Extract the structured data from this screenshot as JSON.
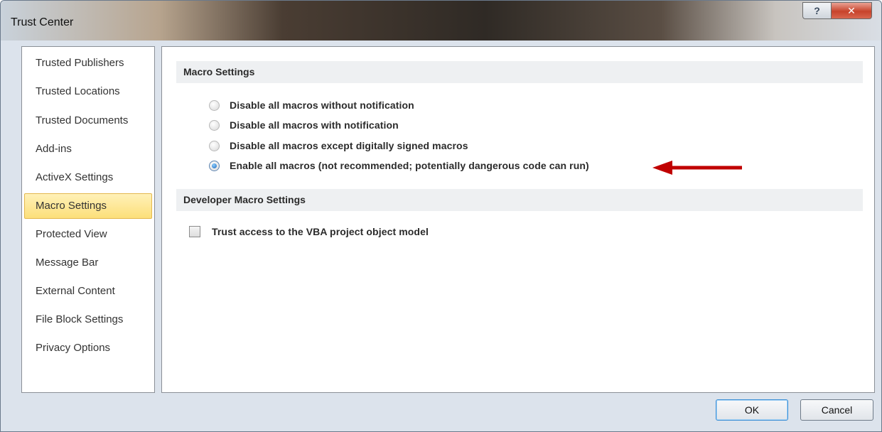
{
  "window": {
    "title": "Trust Center",
    "help_glyph": "?",
    "close_glyph": "✕"
  },
  "nav": {
    "items": [
      {
        "label": "Trusted Publishers"
      },
      {
        "label": "Trusted Locations"
      },
      {
        "label": "Trusted Documents"
      },
      {
        "label": "Add-ins"
      },
      {
        "label": "ActiveX Settings"
      },
      {
        "label": "Macro Settings",
        "selected": true
      },
      {
        "label": "Protected View"
      },
      {
        "label": "Message Bar"
      },
      {
        "label": "External Content"
      },
      {
        "label": "File Block Settings"
      },
      {
        "label": "Privacy Options"
      }
    ]
  },
  "macro_settings": {
    "header": "Macro Settings",
    "options": [
      {
        "label": "Disable all macros without notification",
        "checked": false
      },
      {
        "label": "Disable all macros with notification",
        "checked": false
      },
      {
        "label": "Disable all macros except digitally signed macros",
        "checked": false
      },
      {
        "label": "Enable all macros (not recommended; potentially dangerous code can run)",
        "checked": true
      }
    ]
  },
  "developer_settings": {
    "header": "Developer Macro Settings",
    "checkbox_label": "Trust access to the VBA project object model",
    "checked": false
  },
  "buttons": {
    "ok": "OK",
    "cancel": "Cancel"
  },
  "colors": {
    "selected_nav_bg": "#fcdf7a",
    "arrow": "#c00000",
    "close_button": "#c7432b"
  }
}
